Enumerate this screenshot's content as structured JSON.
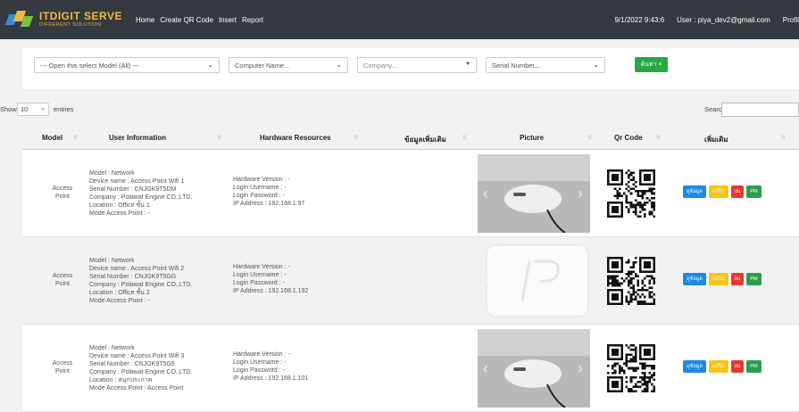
{
  "nav": {
    "logo_title": "ITDIGIT SERVE",
    "logo_sub": "DIFFERENT SOLUTION",
    "links": [
      "Home",
      "Create QR Code",
      "Insert",
      "Report"
    ],
    "datetime": "9/1/2022 9:43:6",
    "user": "User : piya_dev2@gmail.com",
    "profile": "Profil"
  },
  "filters": {
    "model": "--- Open this select Model (All) ---",
    "computer": "Computer Name...",
    "company": "Company...",
    "serial": "Serial Number...",
    "search_button": "ค้นหา"
  },
  "datatable": {
    "show": "Show",
    "length": "10",
    "entries": "entries",
    "search_label": "Search:"
  },
  "table": {
    "headers": [
      "Model",
      "User Information",
      "Hardware Resources",
      "ข้อมูลเพิ่มเติม",
      "Picture",
      "Qr Code",
      "เพิ่มเติม"
    ],
    "rows": [
      {
        "model_line1": "Access",
        "model_line2": "Point",
        "info": [
          "Model : Network",
          "Device name : Access Point Wifi 1",
          "Serial Number : CNJGK9T5DM",
          "Company : Polawat Engine CO.,LTD.",
          "Location : Office ชั้น 1",
          "Mode Access Point : -"
        ],
        "hw": [
          "Hardware Version : -",
          "Login Username : -",
          "Login Password : -",
          "IP Address : 192.168.1.97"
        ]
      },
      {
        "model_line1": "Access",
        "model_line2": "Point",
        "info": [
          "Model : Network",
          "Device name : Access Point Wifi 2",
          "Serial Number : CNJGK9T5GG",
          "Company : Polawat Engine CO.,LTD.",
          "Location : Office ชั้น 2",
          "Mode Access Point : -"
        ],
        "hw": [
          "Hardware Version : -",
          "Login Username : -",
          "Login Password : -",
          "IP Address : 192.168.1.192"
        ]
      },
      {
        "model_line1": "Access",
        "model_line2": "Point",
        "info": [
          "Model : Network",
          "Device name : Access Point Wifi 3",
          "Serial Number : CNJGK9T5G5",
          "Company : Polawat Engine CO.,LTD.",
          "Location : สนุกประกาศ",
          "Mode Access Point : Access Point"
        ],
        "hw": [
          "Hardware Version : -",
          "Login Username : -",
          "Login Password : -",
          "IP Address : 192.168.1.101"
        ]
      }
    ],
    "buttons": {
      "detail": "ดูข้อมูล",
      "edit": "แก้ไข",
      "delete": "ลบ",
      "pm": "PM"
    }
  },
  "colors": {
    "navbar": "#343a40",
    "logo": "#f5b83c",
    "search": "#28a745",
    "detail": "#1e88e5",
    "edit": "#f5c518",
    "delete": "#e53935",
    "pm": "#2e9c4e"
  }
}
